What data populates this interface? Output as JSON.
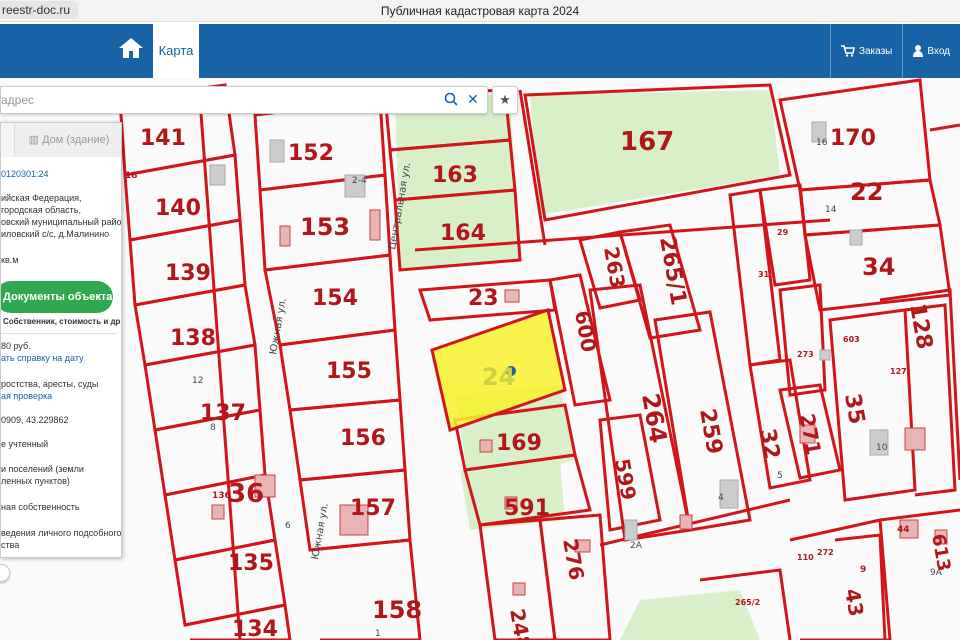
{
  "browser": {
    "url": "reestr-doc.ru",
    "title": "Публичная кадастровая карта 2024"
  },
  "navbar": {
    "map_tab": "Карта",
    "orders": "Заказы",
    "login": "Вход"
  },
  "search": {
    "placeholder": "адрес"
  },
  "panel": {
    "tab_house": "Дом (здание)",
    "cadastral_number": "0120301:24",
    "address_lines": [
      "ийская Федерация,",
      "городская область,",
      "овский муниципальный район,",
      "иловский с/с, д.Малинино"
    ],
    "area": "кв.м",
    "documents_button": "Документы объекта",
    "documents_sub": "Собственник, стоимость и др.",
    "value": "80 руб.",
    "value_link": "ать справку на дату",
    "restrictions": "ростства, аресты, суды",
    "restrictions_link": "ая проверка",
    "coords": "0909, 43.229862",
    "status": "е учтенный",
    "category_lines": [
      "и поселений (земли",
      "ленных пунктов)"
    ],
    "ownership": "ная собственность",
    "use_lines": [
      "ведения личного подсобного",
      "ства"
    ]
  },
  "map": {
    "parcel_labels": [
      {
        "text": "141"
      },
      {
        "text": "18"
      },
      {
        "text": "140"
      },
      {
        "text": "139"
      },
      {
        "text": "138"
      },
      {
        "text": "137"
      },
      {
        "text": "136"
      },
      {
        "text": "36"
      },
      {
        "text": "135"
      },
      {
        "text": "134"
      },
      {
        "text": "152"
      },
      {
        "text": "153"
      },
      {
        "text": "154"
      },
      {
        "text": "155"
      },
      {
        "text": "156"
      },
      {
        "text": "157"
      },
      {
        "text": "158"
      },
      {
        "text": "163"
      },
      {
        "text": "164"
      },
      {
        "text": "167"
      },
      {
        "text": "23"
      },
      {
        "text": "24"
      },
      {
        "text": "169"
      },
      {
        "text": "591"
      },
      {
        "text": "248"
      },
      {
        "text": "276"
      },
      {
        "text": "600"
      },
      {
        "text": "263"
      },
      {
        "text": "265/1"
      },
      {
        "text": "264"
      },
      {
        "text": "259"
      },
      {
        "text": "599"
      },
      {
        "text": "32"
      },
      {
        "text": "31"
      },
      {
        "text": "29"
      },
      {
        "text": "273"
      },
      {
        "text": "271"
      },
      {
        "text": "170"
      },
      {
        "text": "22"
      },
      {
        "text": "34"
      },
      {
        "text": "128"
      },
      {
        "text": "127"
      },
      {
        "text": "35"
      },
      {
        "text": "603"
      },
      {
        "text": "613"
      },
      {
        "text": "265/2"
      },
      {
        "text": "43"
      },
      {
        "text": "9"
      },
      {
        "text": "110"
      },
      {
        "text": "272"
      },
      {
        "text": "44"
      }
    ],
    "small_labels": [
      "2-4",
      "16",
      "14",
      "10",
      "12",
      "8",
      "6",
      "4",
      "5",
      "2A",
      "1",
      "9A"
    ],
    "street_labels": [
      "Центральная ул.",
      "Южная ул.",
      "Южная ул."
    ]
  }
}
